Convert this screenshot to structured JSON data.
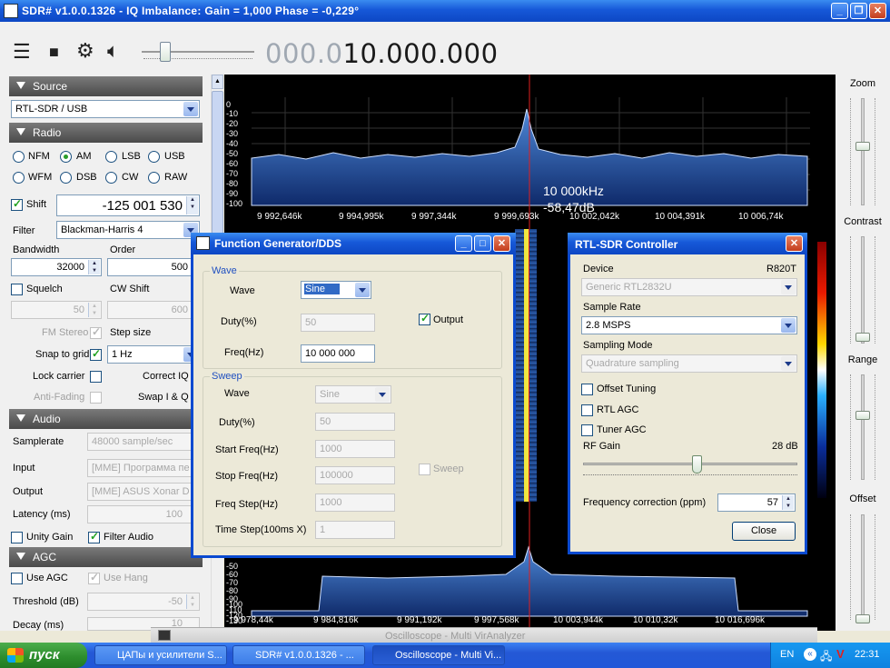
{
  "window": {
    "title": "SDR# v1.0.0.1326 - IQ Imbalance: Gain = 1,000 Phase = -0,229°"
  },
  "toolbar": {
    "freq_dim": "000.0",
    "freq_bright": "10.000.000"
  },
  "source": {
    "header": "Source",
    "device": "RTL-SDR / USB"
  },
  "radio": {
    "header": "Radio",
    "modes": [
      "NFM",
      "AM",
      "LSB",
      "USB",
      "WFM",
      "DSB",
      "CW",
      "RAW"
    ],
    "selected_mode": "AM",
    "shift_label": "Shift",
    "shift_value": "-125 001 530",
    "filter_label": "Filter",
    "filter_value": "Blackman-Harris 4",
    "bandwidth_label": "Bandwidth",
    "bandwidth_value": "32000",
    "order_label": "Order",
    "order_value": "500",
    "squelch_label": "Squelch",
    "squelch_value": "50",
    "cwshift_label": "CW Shift",
    "cwshift_value": "600",
    "fmstereo_label": "FM Stereo",
    "stepsize_label": "Step size",
    "snap_label": "Snap to grid",
    "step_value": "1 Hz",
    "lockcarrier_label": "Lock carrier",
    "correctiq_label": "Correct IQ",
    "antifading_label": "Anti-Fading",
    "swapiq_label": "Swap I & Q"
  },
  "audio": {
    "header": "Audio",
    "samplerate_label": "Samplerate",
    "samplerate_value": "48000 sample/sec",
    "input_label": "Input",
    "input_value": "[MME] Программа пе",
    "output_label": "Output",
    "output_value": "[MME] ASUS Xonar D",
    "latency_label": "Latency (ms)",
    "latency_value": "100",
    "unity_label": "Unity Gain",
    "filter_audio_label": "Filter Audio"
  },
  "agc": {
    "header": "AGC",
    "use_agc_label": "Use AGC",
    "use_hang_label": "Use Hang",
    "threshold_label": "Threshold (dB)",
    "threshold_value": "-50",
    "decay_label": "Decay (ms)",
    "decay_value": "10"
  },
  "spectrum": {
    "db_labels": [
      "0",
      "-10",
      "-20",
      "-30",
      "-40",
      "-50",
      "-60",
      "-70",
      "-80",
      "-90",
      "-100"
    ],
    "freq_labels": [
      "9 992,646k",
      "9 994,995k",
      "9 997,344k",
      "9 999,693k",
      "10 002,042k",
      "10 004,391k",
      "10 006,74k"
    ],
    "cursor_freq": "10 000kHz",
    "cursor_db": "-58,47dB"
  },
  "spectrum2": {
    "db_labels": [
      "-50",
      "-60",
      "-70",
      "-80",
      "-90",
      "-100",
      "-110",
      "-120",
      "-130"
    ],
    "freq_labels": [
      "9 978,44k",
      "9 984,816k",
      "9 991,192k",
      "9 997,568k",
      "10 003,944k",
      "10 010,32k",
      "10 016,696k"
    ]
  },
  "right_panel": {
    "zoom": "Zoom",
    "contrast": "Contrast",
    "range": "Range",
    "offset": "Offset"
  },
  "funcgen": {
    "title": "Function Generator/DDS",
    "wave_group": "Wave",
    "wave_label": "Wave",
    "wave_value": "Sine",
    "duty_label": "Duty(%)",
    "duty_value": "50",
    "output_label": "Output",
    "freq_label": "Freq(Hz)",
    "freq_value": "10 000 000",
    "sweep_group": "Sweep",
    "sweep_wave_label": "Wave",
    "sweep_wave_value": "Sine",
    "sweep_duty_label": "Duty(%)",
    "sweep_duty_value": "50",
    "start_label": "Start Freq(Hz)",
    "start_value": "1000",
    "stop_label": "Stop Freq(Hz)",
    "stop_value": "100000",
    "step_label": "Freq Step(Hz)",
    "step_value": "1000",
    "time_label": "Time Step(100ms X)",
    "time_value": "1",
    "sweep_label": "Sweep"
  },
  "rtl": {
    "title": "RTL-SDR Controller",
    "device_label": "Device",
    "tuner": "R820T",
    "device_value": "Generic RTL2832U",
    "samplerate_label": "Sample Rate",
    "samplerate_value": "2.8 MSPS",
    "mode_label": "Sampling Mode",
    "mode_value": "Quadrature sampling",
    "offset_label": "Offset Tuning",
    "rtlagc_label": "RTL AGC",
    "tuneragc_label": "Tuner AGC",
    "rfgain_label": "RF Gain",
    "rfgain_value": "28 dB",
    "freqcorr_label": "Frequency correction (ppm)",
    "freqcorr_value": "57",
    "close_label": "Close"
  },
  "background_window": {
    "title": "Oscilloscope - Multi VirAnalyzer"
  },
  "taskbar": {
    "start": "пуск",
    "tasks": [
      "ЦАПы и усилители S...",
      "SDR# v1.0.0.1326 - ...",
      "Oscilloscope - Multi Vi..."
    ],
    "lang": "EN",
    "time": "22:31"
  },
  "colors": {
    "xp_blue": "#0d47c4",
    "spectrum_fill": "#2f62b8",
    "center_line": "#e02020",
    "start_green": "#2c8c2c"
  }
}
